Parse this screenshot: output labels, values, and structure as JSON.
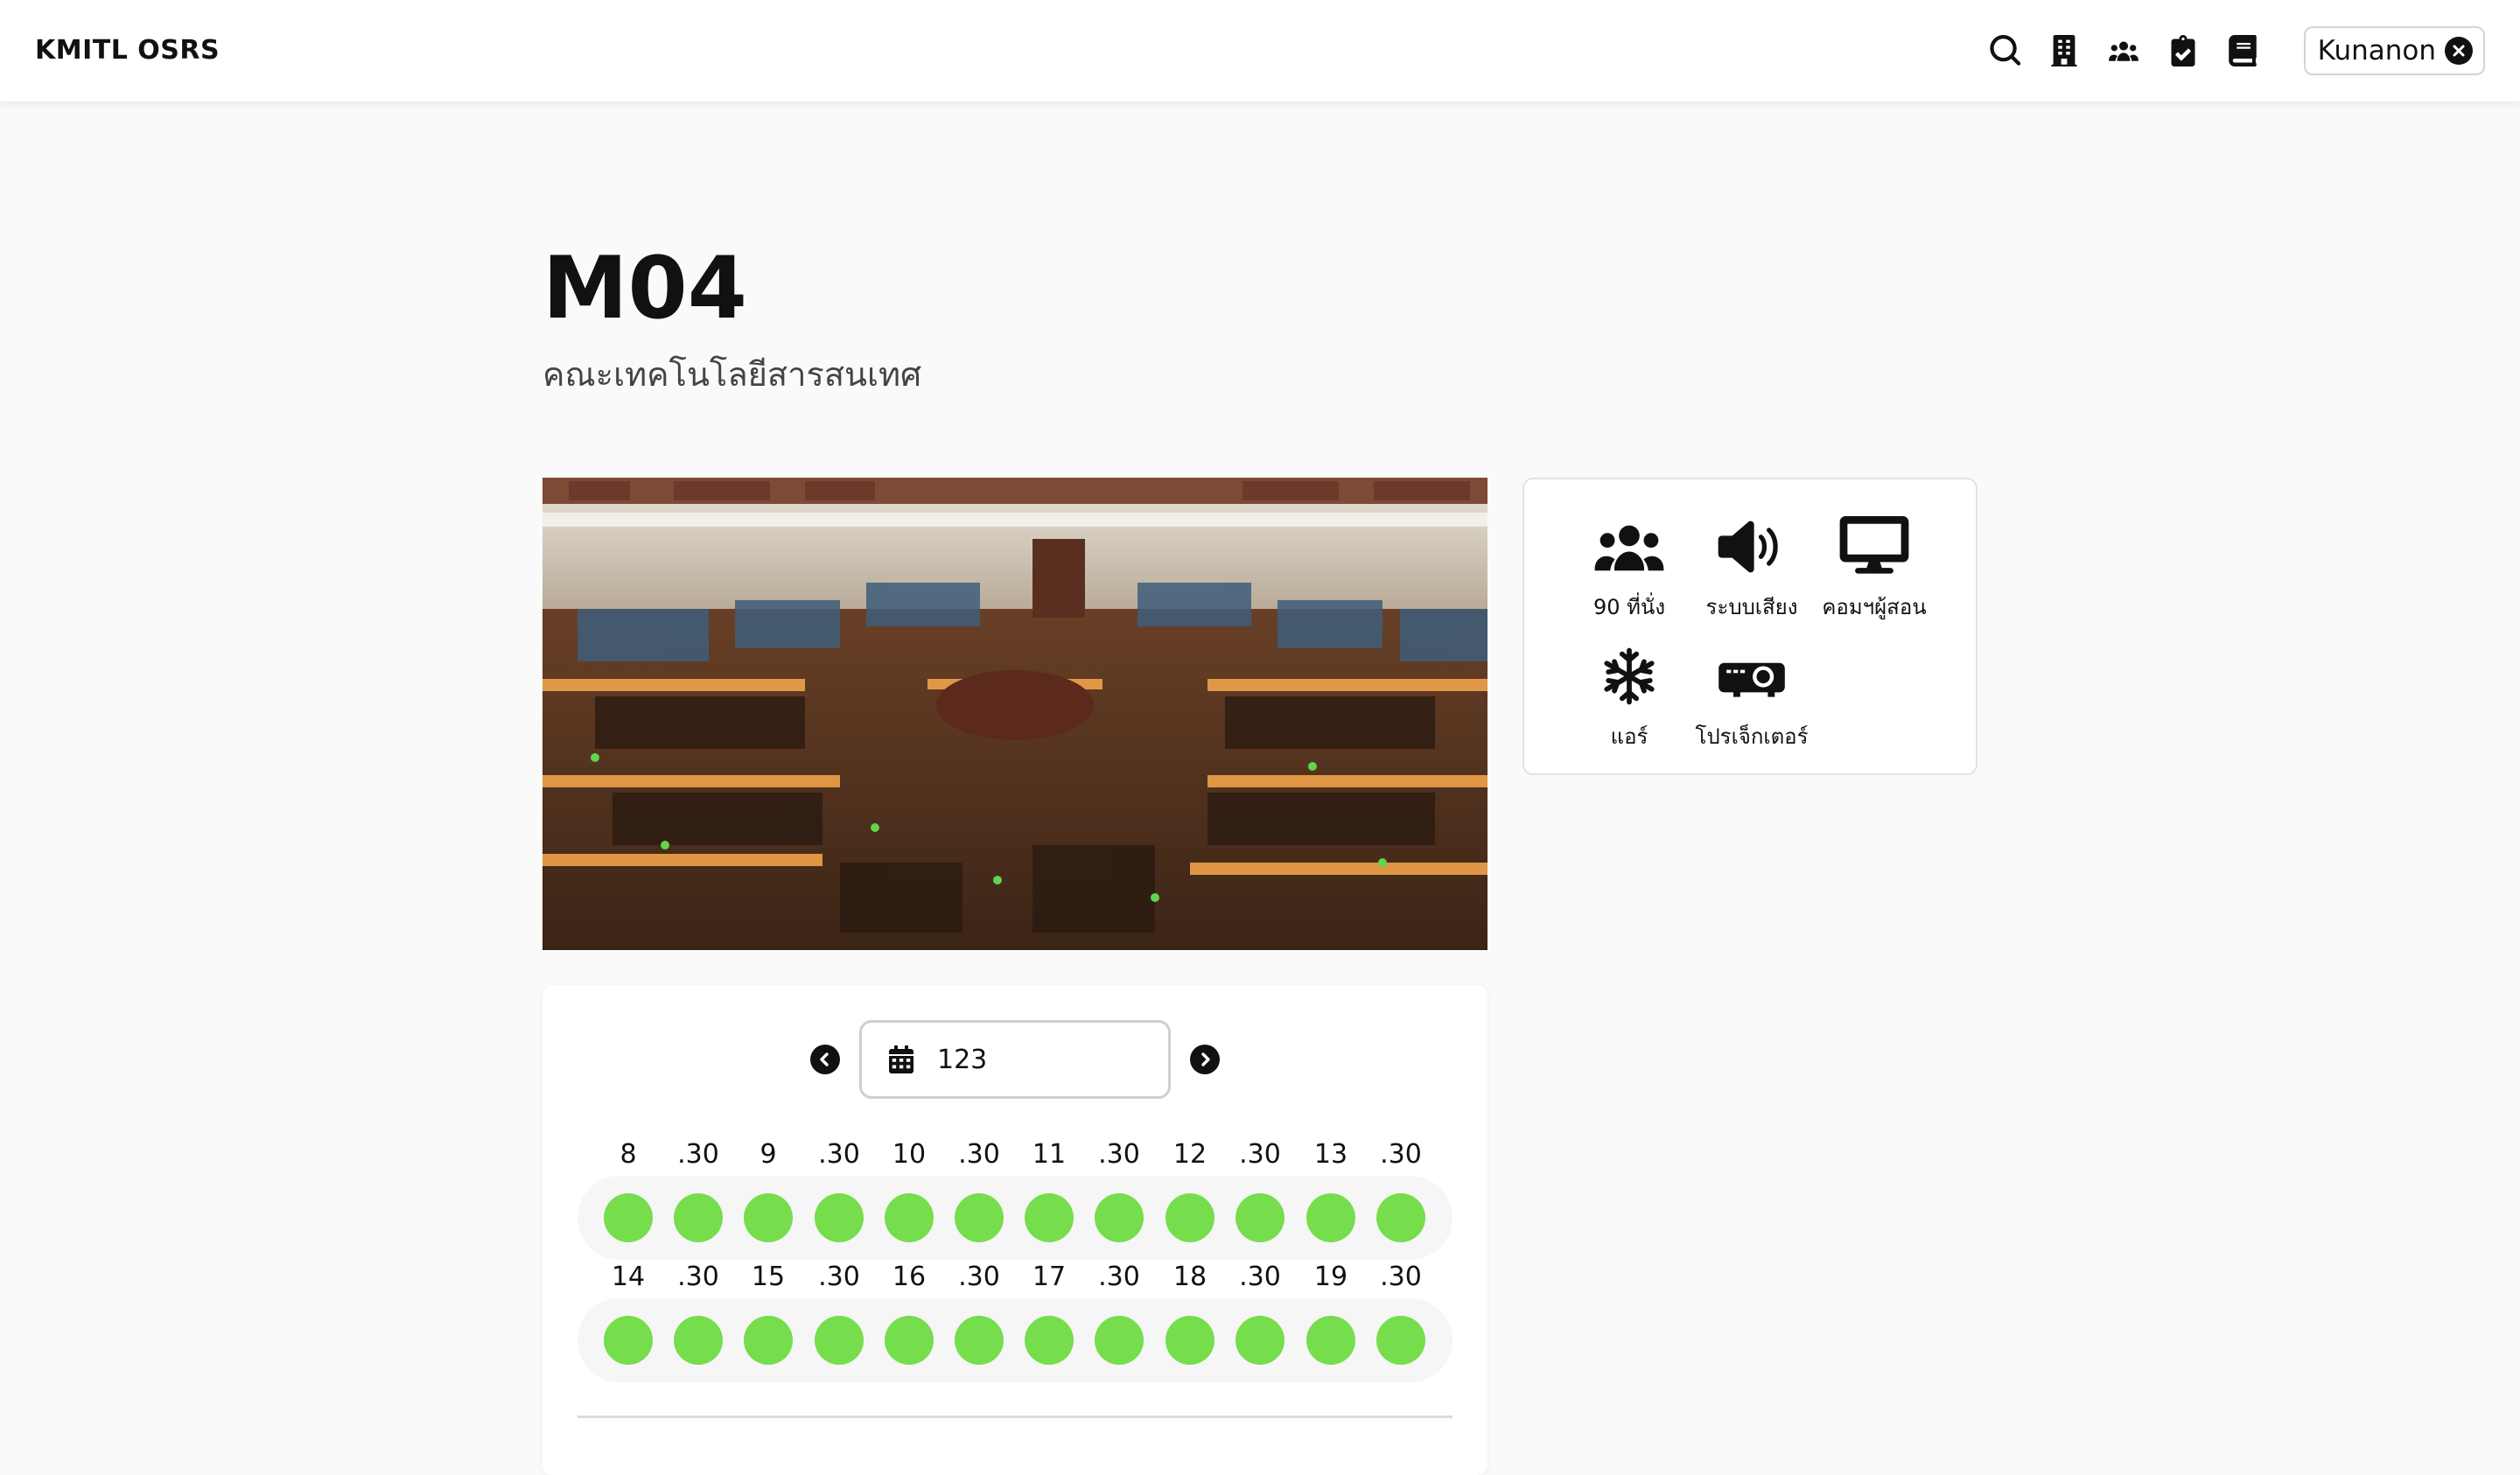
{
  "navbar": {
    "brand": "KMITL OSRS",
    "icons": [
      "search-icon",
      "building-icon",
      "users-icon",
      "clipboard-check-icon",
      "book-icon"
    ],
    "user_name": "Kunanon"
  },
  "room": {
    "code": "M04",
    "faculty": "คณะเทคโนโลยีสารสนเทศ",
    "photo_alt": "library reading room"
  },
  "amenities": [
    {
      "icon": "users-icon",
      "label": "90 ที่นั่ง"
    },
    {
      "icon": "speaker-icon",
      "label": "ระบบเสียง"
    },
    {
      "icon": "monitor-icon",
      "label": "คอมฯผู้สอน"
    },
    {
      "icon": "snowflake-icon",
      "label": "แอร์"
    },
    {
      "icon": "projector-icon",
      "label": "โปรเจ็กเตอร์"
    }
  ],
  "booking": {
    "date_value": "123",
    "colors": {
      "available": "#76dd4d"
    },
    "rows": [
      {
        "labels": [
          "8",
          ".30",
          "9",
          ".30",
          "10",
          ".30",
          "11",
          ".30",
          "12",
          ".30",
          "13",
          ".30"
        ],
        "status": [
          "available",
          "available",
          "available",
          "available",
          "available",
          "available",
          "available",
          "available",
          "available",
          "available",
          "available",
          "available"
        ]
      },
      {
        "labels": [
          "14",
          ".30",
          "15",
          ".30",
          "16",
          ".30",
          "17",
          ".30",
          "18",
          ".30",
          "19",
          ".30"
        ],
        "status": [
          "available",
          "available",
          "available",
          "available",
          "available",
          "available",
          "available",
          "available",
          "available",
          "available",
          "available",
          "available"
        ]
      }
    ]
  }
}
